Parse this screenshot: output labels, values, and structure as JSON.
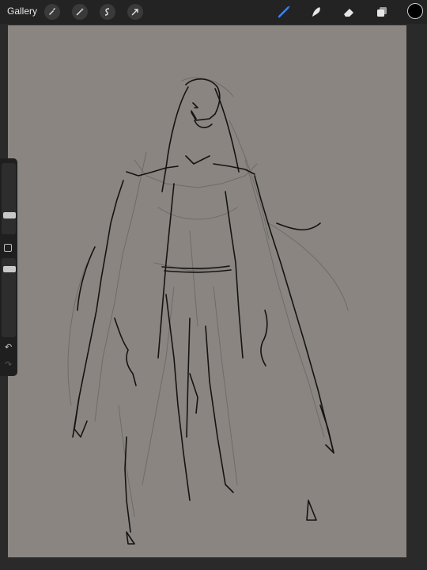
{
  "topbar": {
    "gallery_label": "Gallery",
    "left_tools": [
      "wrench-icon",
      "magic-wand-icon",
      "selection-icon",
      "transform-arrow-icon"
    ],
    "right_tools": [
      "brush-icon",
      "smudge-icon",
      "eraser-icon",
      "layers-icon"
    ],
    "active_tool": "brush-icon",
    "active_color": "#000000",
    "accent_color": "#3b82f6"
  },
  "canvas": {
    "background": "#8a8580",
    "content": "sketch-drawing"
  },
  "sidebar": {
    "brush_size_level": 0.45,
    "opacity_level": 0.8,
    "undo_icon": "undo-icon",
    "redo_icon": "redo-icon"
  }
}
